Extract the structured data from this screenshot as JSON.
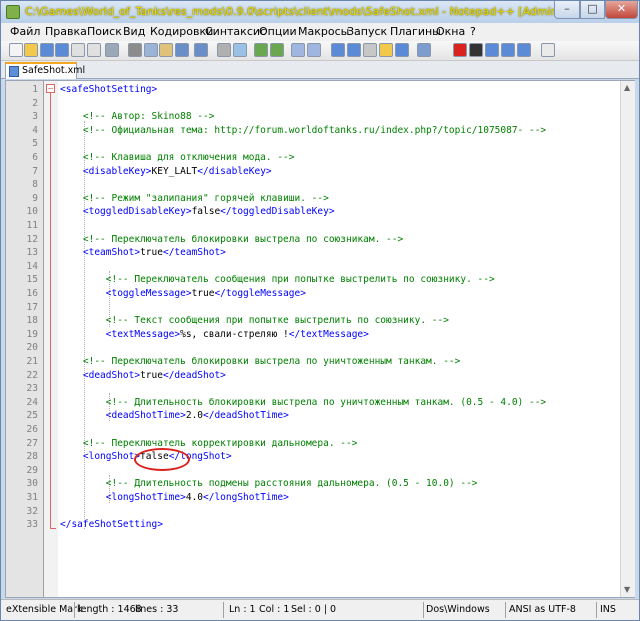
{
  "window": {
    "title": "C:\\Games\\World_of_Tanks\\res_mods\\0.9.0\\scripts\\client\\mods\\SafeShot.xml - Notepad++ [Administrator]",
    "min": "–",
    "max": "□",
    "close": "✕"
  },
  "menu": [
    "Файл",
    "Правка",
    "Поиск",
    "Вид",
    "Кодировки",
    "Синтаксис",
    "Опции",
    "Макросы",
    "Запуск",
    "Плагины",
    "Окна",
    "?"
  ],
  "tab": {
    "label": "SafeShot.xml"
  },
  "editor": {
    "lines": [
      {
        "n": "1",
        "parts": [
          [
            "t",
            "<safeShotSetting>"
          ]
        ]
      },
      {
        "n": "2",
        "parts": []
      },
      {
        "n": "3",
        "parts": [
          [
            "c",
            "    <!-- Автор: Skino88 -->"
          ]
        ]
      },
      {
        "n": "4",
        "parts": [
          [
            "c",
            "    <!-- Официальная тема: http://forum.worldoftanks.ru/index.php?/topic/1075087- -->"
          ]
        ]
      },
      {
        "n": "5",
        "parts": []
      },
      {
        "n": "6",
        "parts": [
          [
            "c",
            "    <!-- Клавиша для отключения мода. -->"
          ]
        ]
      },
      {
        "n": "7",
        "parts": [
          [
            "t",
            "    <disableKey>"
          ],
          [
            "x",
            "KEY_LALT"
          ],
          [
            "t",
            "</disableKey>"
          ]
        ]
      },
      {
        "n": "8",
        "parts": []
      },
      {
        "n": "9",
        "parts": [
          [
            "c",
            "    <!-- Режим \"залипания\" горячей клавиши. -->"
          ]
        ]
      },
      {
        "n": "10",
        "parts": [
          [
            "t",
            "    <toggledDisableKey>"
          ],
          [
            "x",
            "false"
          ],
          [
            "t",
            "</toggledDisableKey>"
          ]
        ]
      },
      {
        "n": "11",
        "parts": []
      },
      {
        "n": "12",
        "parts": [
          [
            "c",
            "    <!-- Переключатель блокировки выстрела по союзникам. -->"
          ]
        ]
      },
      {
        "n": "13",
        "parts": [
          [
            "t",
            "    <teamShot>"
          ],
          [
            "x",
            "true"
          ],
          [
            "t",
            "</teamShot>"
          ]
        ]
      },
      {
        "n": "14",
        "parts": []
      },
      {
        "n": "15",
        "parts": [
          [
            "c",
            "        <!-- Переключатель сообщения при попытке выстрелить по союзнику. -->"
          ]
        ]
      },
      {
        "n": "16",
        "parts": [
          [
            "t",
            "        <toggleMessage>"
          ],
          [
            "x",
            "true"
          ],
          [
            "t",
            "</toggleMessage>"
          ]
        ]
      },
      {
        "n": "17",
        "parts": []
      },
      {
        "n": "18",
        "parts": [
          [
            "c",
            "        <!-- Текст сообщения при попытке выстрелить по союзнику. -->"
          ]
        ]
      },
      {
        "n": "19",
        "parts": [
          [
            "t",
            "        <textMessage>"
          ],
          [
            "x",
            "%s, свали-стреляю !"
          ],
          [
            "t",
            "</textMessage>"
          ]
        ]
      },
      {
        "n": "20",
        "parts": []
      },
      {
        "n": "21",
        "parts": [
          [
            "c",
            "    <!-- Переключатель блокировки выстрела по уничтоженным танкам. -->"
          ]
        ]
      },
      {
        "n": "22",
        "parts": [
          [
            "t",
            "    <deadShot>"
          ],
          [
            "x",
            "true"
          ],
          [
            "t",
            "</deadShot>"
          ]
        ]
      },
      {
        "n": "23",
        "parts": []
      },
      {
        "n": "24",
        "parts": [
          [
            "c",
            "        <!-- Длительность блокировки выстрела по уничтоженным танкам. (0.5 - 4.0) -->"
          ]
        ]
      },
      {
        "n": "25",
        "parts": [
          [
            "t",
            "        <deadShotTime>"
          ],
          [
            "x",
            "2.0"
          ],
          [
            "t",
            "</deadShotTime>"
          ]
        ]
      },
      {
        "n": "26",
        "parts": []
      },
      {
        "n": "27",
        "parts": [
          [
            "c",
            "    <!-- Переключатель корректировки дальномера. -->"
          ]
        ]
      },
      {
        "n": "28",
        "parts": [
          [
            "t",
            "    <longShot>"
          ],
          [
            "x",
            "false"
          ],
          [
            "t",
            "</longShot>"
          ]
        ]
      },
      {
        "n": "29",
        "parts": []
      },
      {
        "n": "30",
        "parts": [
          [
            "c",
            "        <!-- Длительность подмены расстояния дальномера. (0.5 - 10.0) -->"
          ]
        ]
      },
      {
        "n": "31",
        "parts": [
          [
            "t",
            "        <longShotTime>"
          ],
          [
            "x",
            "4.0"
          ],
          [
            "t",
            "</longShotTime>"
          ]
        ]
      },
      {
        "n": "32",
        "parts": []
      },
      {
        "n": "33",
        "parts": [
          [
            "t",
            "</safeShotSetting>"
          ]
        ]
      }
    ]
  },
  "status": {
    "type": "eXtensible Mark",
    "length": "length : 1468",
    "lines": "lines : 33",
    "ln": "Ln : 1",
    "col": "Col : 1",
    "sel": "Sel : 0 | 0",
    "eol": "Dos\\Windows",
    "enc": "ANSI as UTF-8",
    "ins": "INS"
  },
  "icons": [
    "new-file",
    "open-file",
    "save",
    "save-all",
    "close",
    "close-all",
    "print",
    "cut",
    "copy",
    "paste",
    "undo",
    "redo",
    "find",
    "replace",
    "zoom-in",
    "zoom-out",
    "sync-v",
    "sync-h",
    "word-wrap",
    "all-chars",
    "indent-guide",
    "udl",
    "doc-map",
    "func-list",
    "record-macro",
    "stop-macro",
    "play-macro",
    "run-macro-multiple",
    "save-macro",
    "spellcheck"
  ]
}
